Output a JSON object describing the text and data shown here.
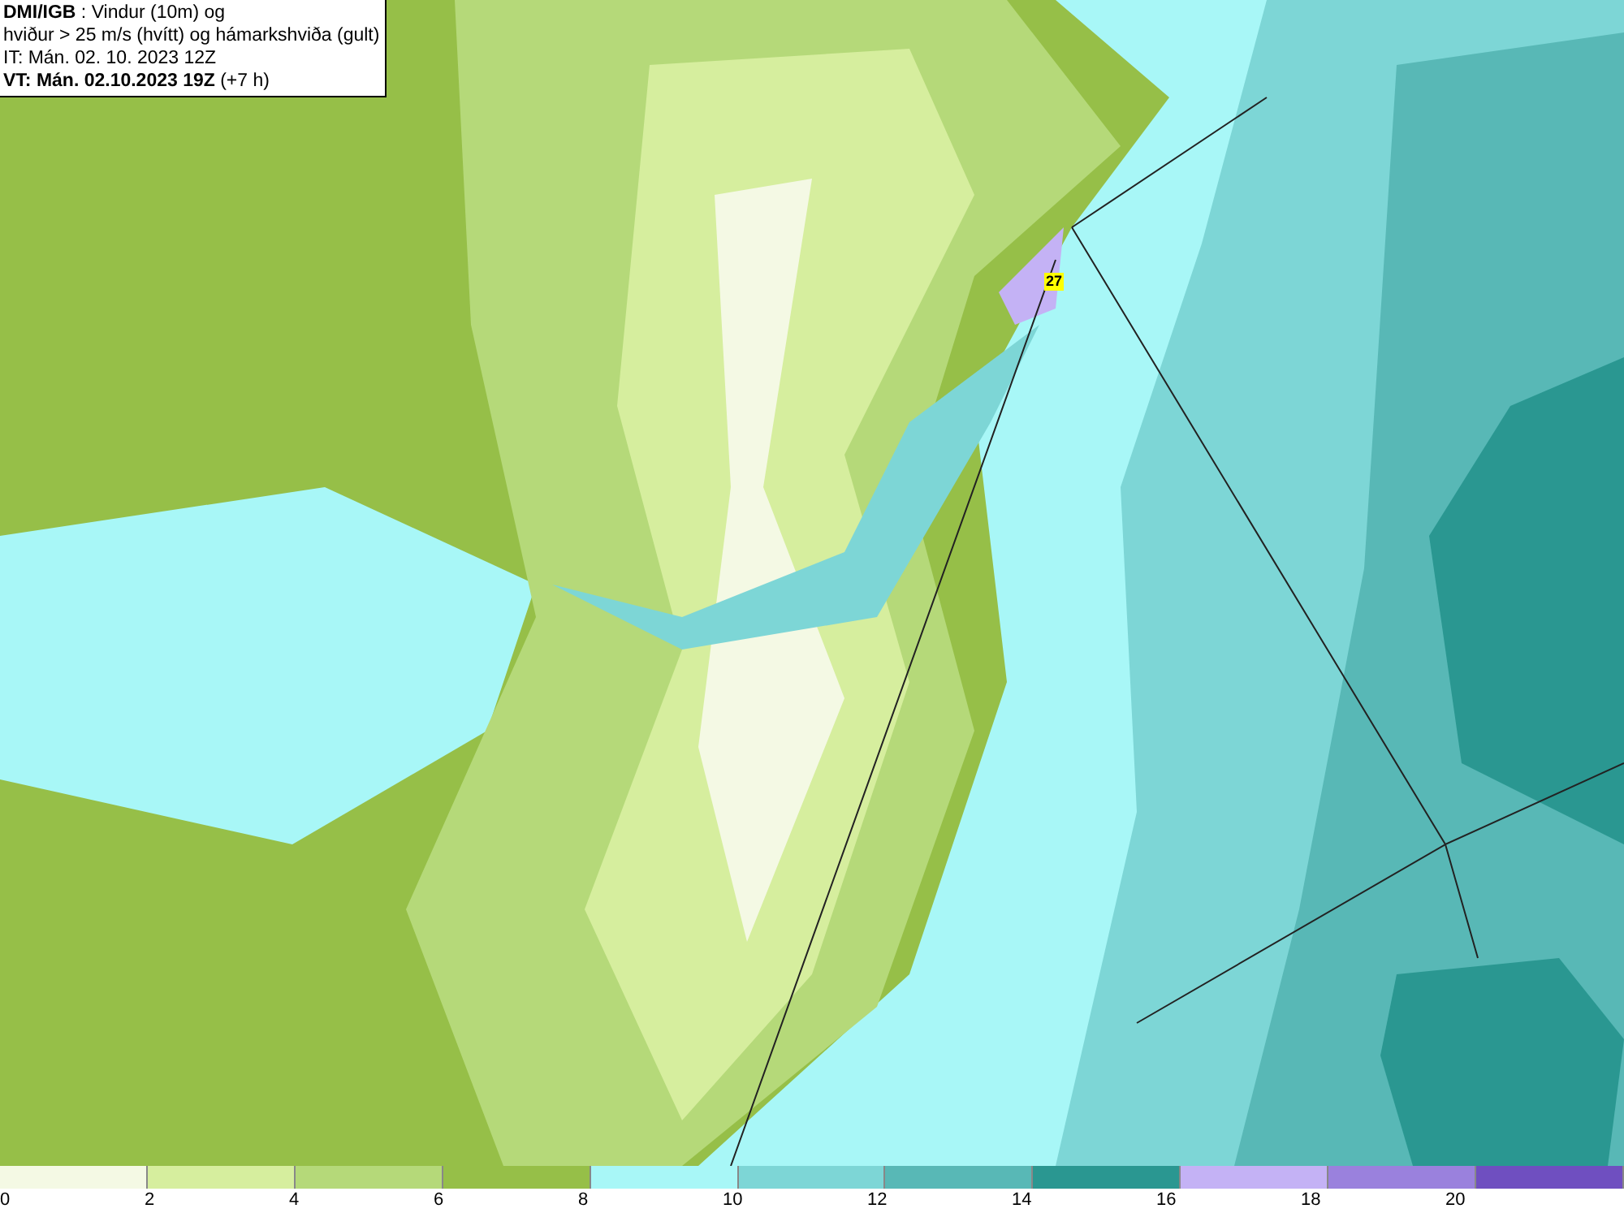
{
  "header": {
    "source": "DMI/IGB",
    "title_rest": " : Vindur (10m) og",
    "line_2": "hviður > 25 m/s (hvítt) og hámarkshviða (gult)",
    "issue_time": "IT: Mán. 02. 10. 2023 12Z",
    "valid_time": "VT: Mán. 02.10.2023 19Z",
    "valid_offset": " (+7 h)"
  },
  "map": {
    "max_gust_label": "27"
  },
  "legend": {
    "bins": [
      {
        "color": "#f4f9e4"
      },
      {
        "color": "#d6ee9e"
      },
      {
        "color": "#b5d979"
      },
      {
        "color": "#96bf48"
      },
      {
        "color": "#a8f7f7"
      },
      {
        "color": "#7dd6d6"
      },
      {
        "color": "#58b8b6"
      },
      {
        "color": "#2a9791"
      },
      {
        "color": "#c4b2f5"
      },
      {
        "color": "#9a81dd"
      },
      {
        "color": "#6f4fc0"
      }
    ],
    "ticks": [
      "0",
      "2",
      "4",
      "6",
      "8",
      "10",
      "12",
      "14",
      "16",
      "18",
      "20"
    ]
  }
}
